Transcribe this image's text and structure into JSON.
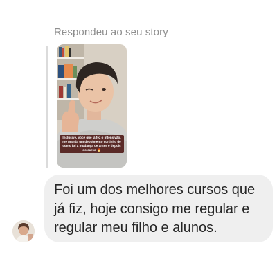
{
  "reply": {
    "label": "Respondeu ao seu story"
  },
  "story": {
    "caption": "Inclusive, você que já fez o intensivão, me manda um depoimento curtinho de como foi a mudança de antes e depois do curso 🔥"
  },
  "message": {
    "text": "Foi um dos melhores cursos que já fiz, hoje consigo me regular e regular meu filho e alunos."
  },
  "colors": {
    "bubble": "#efefef",
    "text": "#262626",
    "label": "#8e8e8e",
    "caption_bg": "#5a2a27"
  }
}
